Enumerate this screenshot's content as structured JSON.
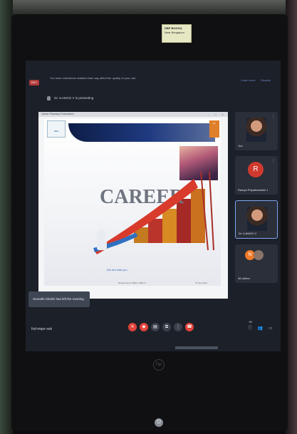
{
  "sticker": {
    "title": "DBP BOGGA",
    "subtitle": "Near Bengaluru"
  },
  "meet": {
    "rec_label": "REC",
    "extension_warning": "You have extensions installed that may affect the quality of your call.",
    "extension_actions": [
      "Learn more",
      "Dismiss"
    ],
    "presenting_text": "Dr. ILANGO V is presenting",
    "browser_tab": "Career Planning Presentation",
    "slide": {
      "logo_text": "MBA",
      "tagline": "We are with you",
      "footer_left": "Department of MBA | CMR IT",
      "footer_right": "27 Sep 2021",
      "tag": "01"
    },
    "participants": [
      {
        "name": "You",
        "type": "photo"
      },
      {
        "name": "Ramya Priyadharshini J",
        "type": "initial",
        "initial": "R"
      },
      {
        "name": "Dr. ILANGO V",
        "type": "photo",
        "active": true
      },
      {
        "name": "46 others",
        "type": "group",
        "initial": "N"
      }
    ],
    "toast": "Sumathi Shalini has left the meeting",
    "meeting_code": "fvd-mqer-xek",
    "participant_count": "50",
    "controls": [
      {
        "name": "mic-off-icon",
        "glyph": "✕"
      },
      {
        "name": "camera-off-icon",
        "glyph": "◉"
      },
      {
        "name": "captions-icon",
        "glyph": "▤"
      },
      {
        "name": "present-icon",
        "glyph": "⧉"
      },
      {
        "name": "more-options-icon",
        "glyph": "⋮"
      },
      {
        "name": "end-call-icon",
        "glyph": "☎"
      }
    ]
  },
  "colors": {
    "end_call": "#e0433b",
    "meet_bg": "#1c2028",
    "active_border": "#7ea5f0"
  }
}
